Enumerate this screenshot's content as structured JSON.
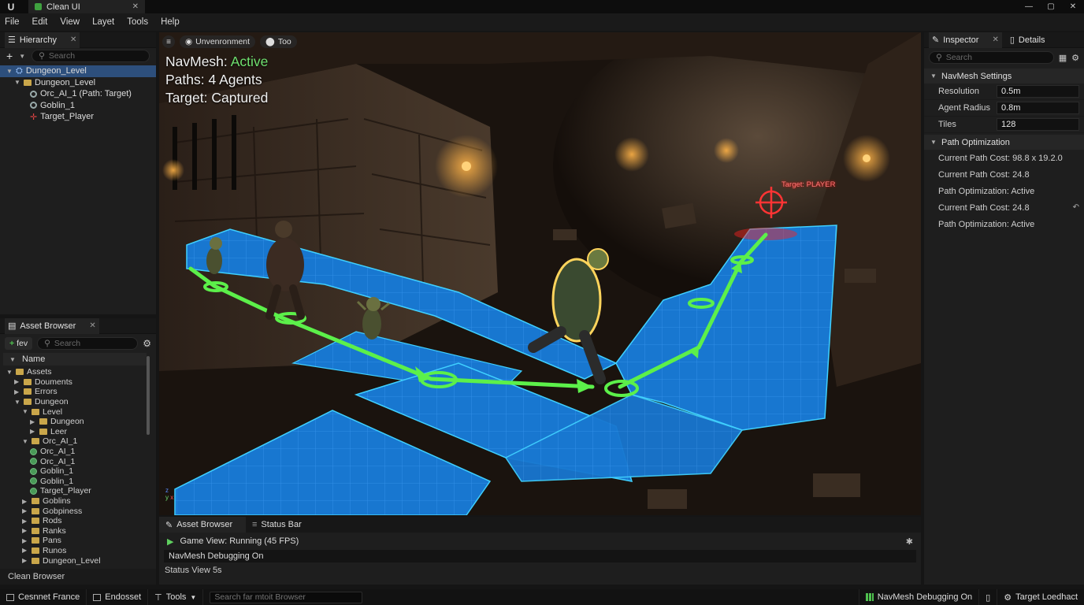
{
  "window": {
    "tab_title": "Clean UI",
    "logo": "U",
    "tab_close": "✕",
    "controls": [
      "—",
      "▢",
      "✕"
    ],
    "colors": {
      "accent": "#2d4f7c",
      "navmesh": "#1a77d6",
      "path": "#5cf04a",
      "target": "#ff3030"
    }
  },
  "menu": [
    "File",
    "Edit",
    "View",
    "Layet",
    "Tools",
    "Help"
  ],
  "hierarchy": {
    "title": "Hierarchy",
    "close": "✕",
    "add": "+",
    "search_placeholder": "Search",
    "items": [
      {
        "label": "Dungeon_Level",
        "icon": "level-icon",
        "selected": true
      },
      {
        "label": "Dungeon_Level",
        "icon": "folder-icon"
      },
      {
        "label": "Orc_AI_1 (Path: Target)",
        "icon": "actor-icon"
      },
      {
        "label": "Goblin_1",
        "icon": "actor-icon"
      },
      {
        "label": "Target_Player",
        "icon": "target-icon"
      }
    ]
  },
  "asset_browser": {
    "title": "Asset Browser",
    "close": "✕",
    "add_label": "fev",
    "search_placeholder": "Search",
    "column": "Name",
    "tree": [
      {
        "label": "Assets",
        "depth": 0,
        "type": "folder",
        "open": true
      },
      {
        "label": "Douments",
        "depth": 1,
        "type": "folder"
      },
      {
        "label": "Errors",
        "depth": 1,
        "type": "folder"
      },
      {
        "label": "Dungeon",
        "depth": 1,
        "type": "folder",
        "open": true
      },
      {
        "label": "Level",
        "depth": 2,
        "type": "folder",
        "open": true
      },
      {
        "label": "Dungeon",
        "depth": 3,
        "type": "folder"
      },
      {
        "label": "Leer",
        "depth": 3,
        "type": "folder"
      },
      {
        "label": "Orc_AI_1",
        "depth": 2,
        "type": "folder",
        "open": true
      },
      {
        "label": "Orc_AI_1",
        "depth": 3,
        "type": "asset"
      },
      {
        "label": "Orc_AI_1",
        "depth": 3,
        "type": "asset"
      },
      {
        "label": "Goblin_1",
        "depth": 3,
        "type": "asset"
      },
      {
        "label": "Goblin_1",
        "depth": 3,
        "type": "asset"
      },
      {
        "label": "Target_Player",
        "depth": 3,
        "type": "asset"
      },
      {
        "label": "Goblins",
        "depth": 2,
        "type": "folder"
      },
      {
        "label": "Gobpiness",
        "depth": 2,
        "type": "folder"
      },
      {
        "label": "Rods",
        "depth": 2,
        "type": "folder"
      },
      {
        "label": "Ranks",
        "depth": 2,
        "type": "folder"
      },
      {
        "label": "Pans",
        "depth": 2,
        "type": "folder"
      },
      {
        "label": "Runos",
        "depth": 2,
        "type": "folder"
      },
      {
        "label": "Dungeon_Level",
        "depth": 2,
        "type": "folder"
      }
    ],
    "footer": "Clean Browser"
  },
  "viewport": {
    "menu_icon": "≡",
    "env_pill": "Unvenronment",
    "top_pill": "Too",
    "hud": {
      "navmesh_label": "NavMesh:",
      "navmesh_status": "Active",
      "paths": "Paths: 4 Agents",
      "target": "Target: Captured"
    },
    "target_label": "Target: PLAYER",
    "axis": {
      "x": "x",
      "y": "y",
      "z": "z"
    }
  },
  "bottom_panel": {
    "tabs": [
      "Asset Browser",
      "Status Bar"
    ],
    "game_view": "Game View: Running (45 FPS)",
    "navmesh_debug": "NavMesh Debugging On",
    "status_view": "Status View 5s"
  },
  "inspector": {
    "tabs": [
      "Inspector",
      "Details"
    ],
    "close": "✕",
    "search_placeholder": "Search",
    "sections": {
      "navmesh": "NavMesh Settings",
      "path": "Path Optimization"
    },
    "navmesh_props": [
      {
        "label": "Resolution",
        "value": "0.5m"
      },
      {
        "label": "Agent Radius",
        "value": "0.8m"
      },
      {
        "label": "Tiles",
        "value": "128"
      }
    ],
    "path_props": [
      "Current Path Cost: 98.8 x 19.2.0",
      "Current Path Cost: 24.8",
      "Path Optimization: Active",
      "Current Path Cost: 24.8",
      "Path Optimization: Active"
    ]
  },
  "statusbar": {
    "left": [
      "Cesnnet France",
      "Endosset",
      "Tools"
    ],
    "search_placeholder": "Search far mtoit Browser",
    "right": [
      "NavMesh Debugging On",
      "",
      "Target Loedhact"
    ]
  }
}
